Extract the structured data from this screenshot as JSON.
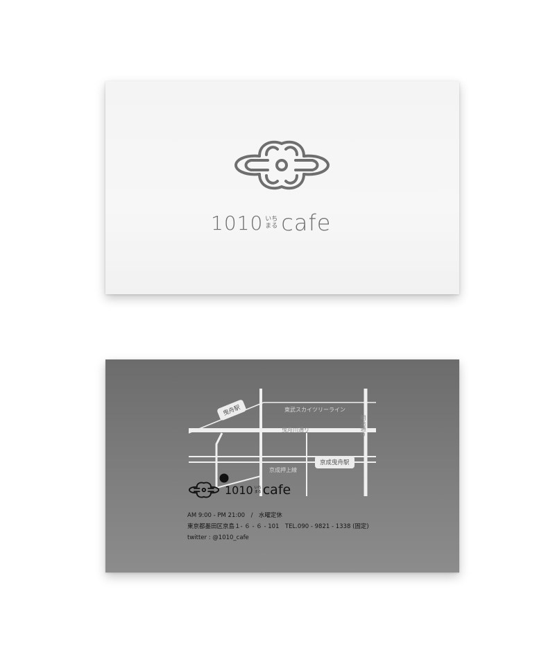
{
  "front": {
    "logo_digits": "1010",
    "logo_kana_top": "いち",
    "logo_kana_bottom": "まる",
    "logo_cafe": "cafe"
  },
  "back": {
    "logo_digits": "1010",
    "logo_kana_top": "いち",
    "logo_kana_bottom": "まる",
    "logo_cafe": "cafe",
    "map": {
      "station_hikifune": "曳舟駅",
      "station_keisei_hikifune": "京成曳舟駅",
      "line_tobu": "東武スカイツリーライン",
      "street_hikifunegawa": "曳舟川通り",
      "line_keisei": "京成押上線",
      "street_meiji": "明治通り"
    },
    "info": {
      "hours": "AM 9:00 - PM 21:00　/　水曜定休",
      "address_tel": "東京都墨田区京島１- ６ - ６ - 101　TEL.090 - 9821 - 1338 (固定)",
      "twitter": "twitter : @1010_cafe"
    }
  },
  "colors": {
    "page_bg": "#ffffff",
    "front_card": "#f5f5f5",
    "back_card": "#7a7a7a",
    "logo_gray": "#6e6e6e",
    "map_road": "#f0f0f0",
    "marker": "#111111"
  },
  "icons": [
    "cloud-knot-logo-icon",
    "location-marker-icon"
  ]
}
